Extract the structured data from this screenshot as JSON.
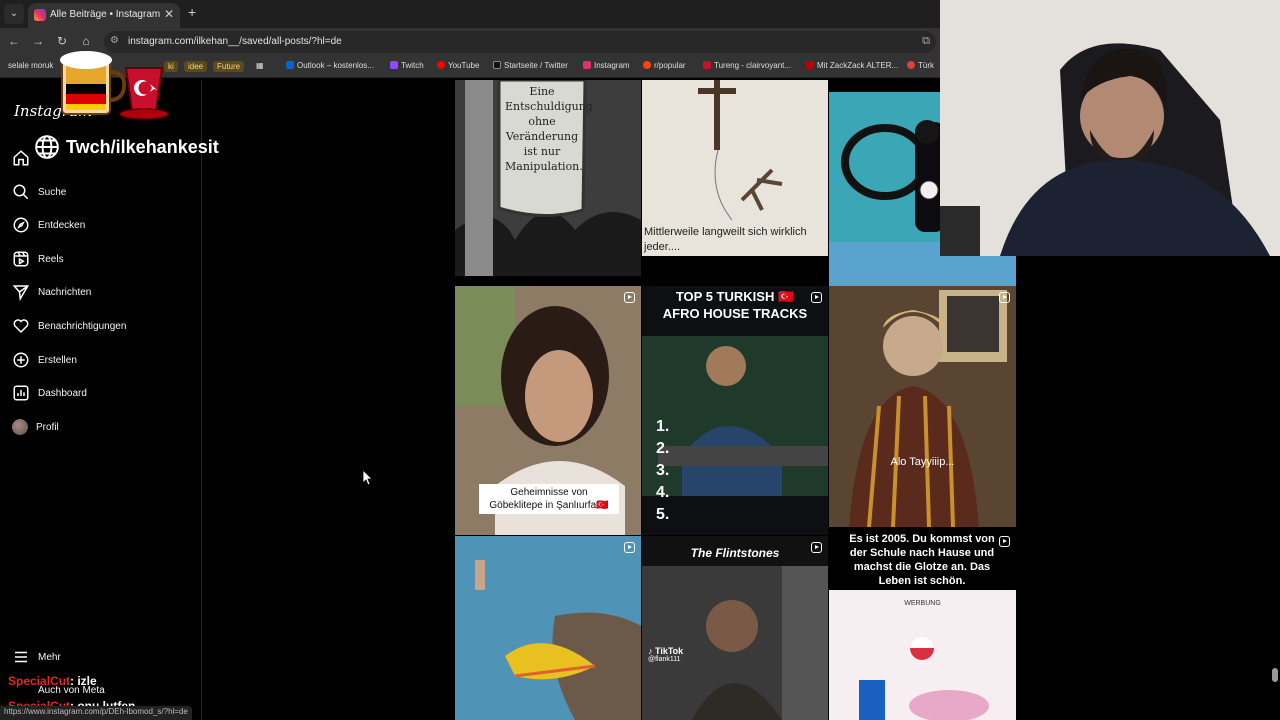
{
  "browser": {
    "tab_title": "Alle Beiträge • Instagram",
    "address": "instagram.com/ilkehan__/saved/all-posts/?hl=de",
    "status_url": "https://www.instagram.com/p/DEh-lbomod_s/?hl=de",
    "bookmarks": [
      "selale moruk",
      "ki",
      "idee",
      "Future",
      "Outlook – kostenlos...",
      "Twitch",
      "YouTube",
      "Startseite / Twitter",
      "Instagram",
      "r/popular",
      "Tureng - clairvoyant...",
      "Mit ZackZack ALTER...",
      "Türk"
    ]
  },
  "sidebar": {
    "logo": "Instagram",
    "items": [
      {
        "label": "Startseite",
        "icon": "home-icon"
      },
      {
        "label": "Suche",
        "icon": "search-icon"
      },
      {
        "label": "Entdecken",
        "icon": "compass-icon"
      },
      {
        "label": "Reels",
        "icon": "reels-icon"
      },
      {
        "label": "Nachrichten",
        "icon": "send-icon"
      },
      {
        "label": "Benachrichtigungen",
        "icon": "heart-icon"
      },
      {
        "label": "Erstellen",
        "icon": "plus-icon"
      },
      {
        "label": "Dashboard",
        "icon": "dashboard-icon"
      },
      {
        "label": "Profil",
        "icon": "avatar-icon"
      }
    ],
    "more": "Mehr",
    "meta": "Auch von Meta"
  },
  "overlay": {
    "handle": "Twch/ilkehankesit",
    "chat": [
      {
        "user": "SpecialCut",
        "message": ": izle"
      },
      {
        "user": "SpecialCut",
        "message": ": onu lutfen"
      }
    ]
  },
  "posts": {
    "p1_sign": "Eine Entschuldigung ohne Veränderung ist nur Manipulation.",
    "p2_caption": "Mittlerweile langweilt sich wirklich jeder....",
    "p4_caption": "Geheimnisse von Göbeklitepe in Şanlıurfa🇹🇷",
    "p5_title": "TOP 5 TURKISH 🇹🇷 AFRO HOUSE TRACKS",
    "p5_list": [
      "1.",
      "2.",
      "3.",
      "4.",
      "5."
    ],
    "p6_caption": "Alo Tayyiiip...",
    "p8_title": "The Flintstones",
    "p8_tiktok": "TikTok",
    "p8_handle": "@flank111",
    "p9_caption": "Es ist 2005. Du kommst von der Schule nach Hause und machst die Glotze an. Das Leben ist schön.",
    "p9_ad": "WERBUNG"
  },
  "colors": {
    "instagram_bg": "#000000",
    "chat_user": "#e02828",
    "chrome_bar": "#333333"
  }
}
